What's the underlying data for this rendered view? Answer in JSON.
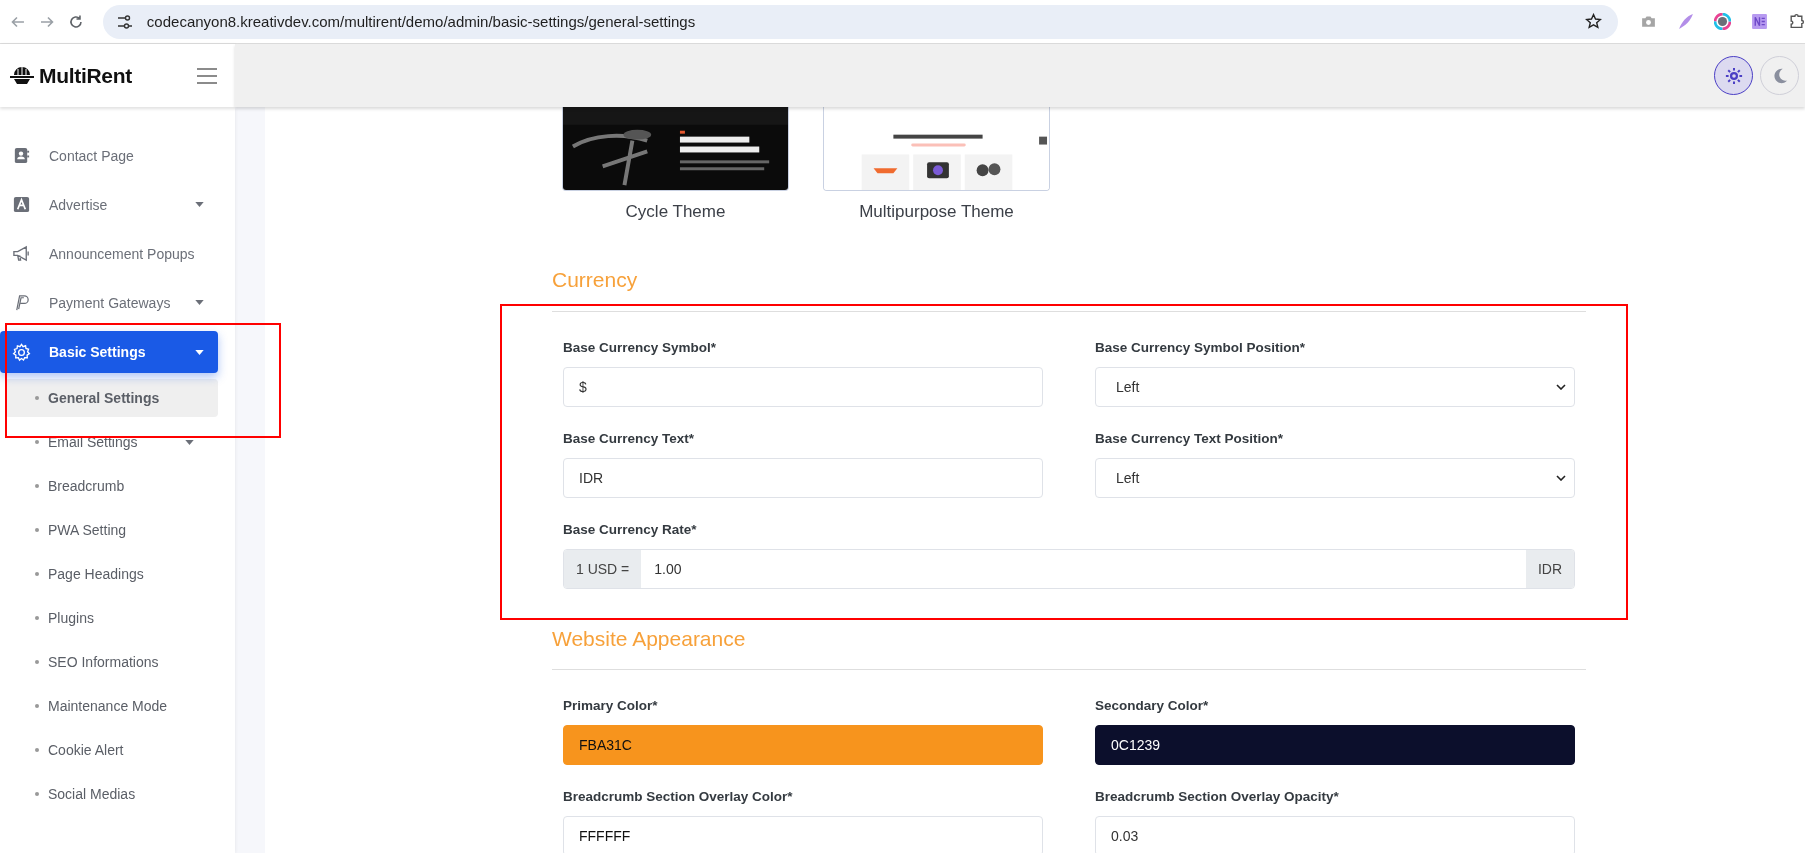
{
  "browser": {
    "url": "codecanyon8.kreativdev.com/multirent/demo/admin/basic-settings/general-settings"
  },
  "sidebar": {
    "brand": "MultiRent",
    "items": [
      {
        "label": "Contact Page",
        "has_submenu": false,
        "selected": false
      },
      {
        "label": "Advertise",
        "has_submenu": true,
        "selected": false
      },
      {
        "label": "Announcement Popups",
        "has_submenu": false,
        "selected": false
      },
      {
        "label": "Payment Gateways",
        "has_submenu": true,
        "selected": false
      },
      {
        "label": "Basic Settings",
        "has_submenu": true,
        "selected": true,
        "children": [
          {
            "label": "General Settings",
            "has_submenu": false,
            "selected": true
          },
          {
            "label": "Email Settings",
            "has_submenu": true,
            "selected": false
          },
          {
            "label": "Breadcrumb",
            "has_submenu": false,
            "selected": false
          },
          {
            "label": "PWA Setting",
            "has_submenu": false,
            "selected": false
          },
          {
            "label": "Page Headings",
            "has_submenu": false,
            "selected": false
          },
          {
            "label": "Plugins",
            "has_submenu": false,
            "selected": false
          },
          {
            "label": "SEO Informations",
            "has_submenu": false,
            "selected": false
          },
          {
            "label": "Maintenance Mode",
            "has_submenu": false,
            "selected": false
          },
          {
            "label": "Cookie Alert",
            "has_submenu": false,
            "selected": false
          },
          {
            "label": "Social Medias",
            "has_submenu": false,
            "selected": false
          }
        ]
      }
    ]
  },
  "header": {
    "theme_buttons": [
      {
        "kind": "light",
        "selected": true
      },
      {
        "kind": "dark",
        "selected": false
      }
    ]
  },
  "themes": [
    {
      "label": "Cycle Theme",
      "kind": "picture"
    },
    {
      "label": "Multipurpose Theme",
      "kind": "picture"
    }
  ],
  "sections": [
    {
      "title": "Currency",
      "fields": [
        {
          "label": "Base Currency Symbol*",
          "kind": "text",
          "value": "$"
        },
        {
          "label": "Base Currency Symbol Position*",
          "kind": "select",
          "value": "Left"
        },
        {
          "label": "Base Currency Text*",
          "kind": "text",
          "value": "IDR"
        },
        {
          "label": "Base Currency Text Position*",
          "kind": "select",
          "value": "Left"
        },
        {
          "label": "Base Currency Rate*",
          "kind": "group",
          "prefix": "1 USD =",
          "value": "1.00",
          "suffix": "IDR"
        }
      ]
    },
    {
      "title": "Website Appearance",
      "fields": [
        {
          "label": "Primary Color*",
          "kind": "color",
          "value": "FBA31C",
          "color": "#f7941d"
        },
        {
          "label": "Secondary Color*",
          "kind": "color",
          "value": "0C1239",
          "color": "#0c0f2c"
        },
        {
          "label": "Breadcrumb Section Overlay Color*",
          "kind": "color",
          "value": "FFFFFF",
          "color": "#ffffff"
        },
        {
          "label": "Breadcrumb Section Overlay Opacity*",
          "kind": "text",
          "value": "0.03"
        }
      ]
    }
  ]
}
